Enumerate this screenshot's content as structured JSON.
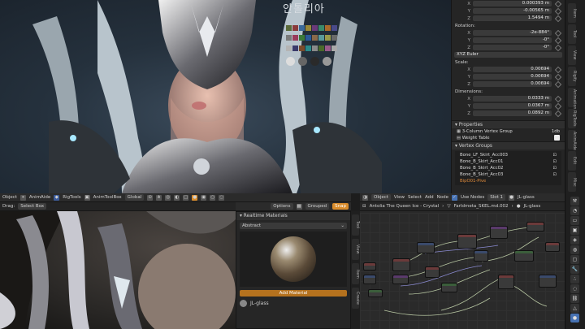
{
  "viewport": {
    "watermark_text": "안톨리아",
    "color_swatches": [
      "#5a6a3a",
      "#8a3a3a",
      "#3a6a9a",
      "#9a8a3a",
      "#6a3a7a",
      "#3a8a6a",
      "#aa6a2a",
      "#4a4a8a",
      "#7a7a7a",
      "#9a3a5a",
      "#3a7a3a",
      "#2a5a9a",
      "#8a6a4a",
      "#5a9a9a",
      "#9a9a4a",
      "#6a6a6a",
      "#b4b4b4",
      "#3a3a6a",
      "#7a4a2a",
      "#2a8a8a",
      "#8a8a8a",
      "#4a6a2a",
      "#9a5a8a",
      "#aaaaaa"
    ]
  },
  "toolbar": {
    "object": "Object",
    "anim_aide": "AnimAide",
    "rig_tools": "RigTools",
    "anim_toolbox": "AnimToolBox",
    "global": "Global",
    "drag": "Drag:",
    "select_box": "Select Box",
    "options": "Options",
    "grouped": "Grouped",
    "snap": "Snap"
  },
  "transform": {
    "location": {
      "x": "0.000393 m",
      "y": "-0.00565 m",
      "z": "1.5494 m"
    },
    "rotation_label": "Rotation:",
    "rotation": {
      "x": "-2e-884°",
      "y": "-0°",
      "z": "-0°"
    },
    "rotation_mode": "XYZ Euler",
    "scale_label": "Scale:",
    "scale": {
      "x": "0.00694",
      "y": "0.00694",
      "z": "0.00694"
    },
    "dimensions_label": "Dimensions:",
    "dimensions": {
      "x": "0.0333 m",
      "y": "0.0367 m",
      "z": "0.0892 m"
    },
    "axis": [
      "X",
      "Y",
      "Z"
    ]
  },
  "properties": {
    "title": "Properties",
    "three_col": "3-Column Vertex Group",
    "three_col_badge": "1db",
    "weight_table": "Weight Table",
    "vertex_groups_title": "Vertex Groups",
    "vertex_groups": [
      "Bone_LF_Skirt_Acc003",
      "Bone_B_Skirt_Acc01",
      "Bone_B_Skirt_Acc02",
      "Bone_B_Skirt_Acc03"
    ],
    "active_group": "BipO01-Pive"
  },
  "tabs_top": [
    "Item",
    "Tool",
    "View",
    "Rigify",
    "Animation",
    "RigTools",
    "AnimAide",
    "Edit",
    "Misc"
  ],
  "materials_panel": {
    "title": "Realtime Materials",
    "category": "Abstract",
    "add_button": "Add Material",
    "material_name": "JL-glass"
  },
  "mat_side_tabs": [
    "Tool",
    "View",
    "Item",
    "Create"
  ],
  "node_editor": {
    "object": "Object",
    "view": "View",
    "select": "Select",
    "add": "Add",
    "node": "Node",
    "use_nodes": "Use Nodes",
    "slot": "Slot 1",
    "material": "JL-glass",
    "breadcrumb": [
      "Antolia The Queen Ice - Crystal",
      "FarIdmeta_SKEL.md.002",
      "JL-glass"
    ]
  },
  "prop_tabs": [
    "tool",
    "render",
    "output",
    "view",
    "scene",
    "world",
    "object",
    "modifiers",
    "particles",
    "physics",
    "constraints",
    "data",
    "material"
  ]
}
